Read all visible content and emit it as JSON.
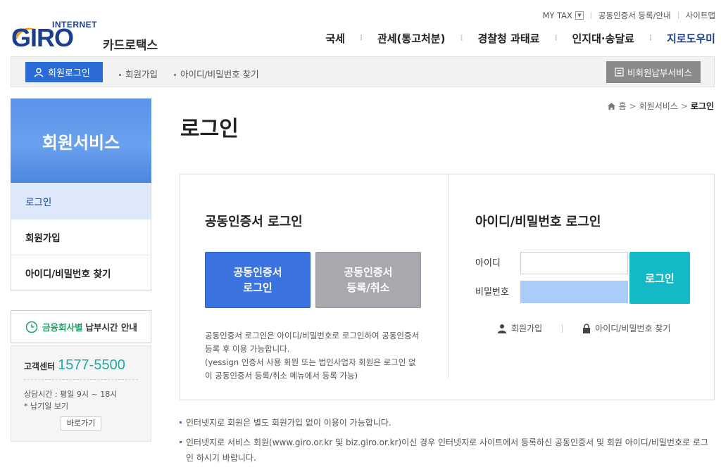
{
  "brand": {
    "internet": "INTERNET",
    "giro": "GIRO",
    "subtitle": "카드로택스",
    "color": "#1a3f8f"
  },
  "util_links": [
    "MY TAX",
    "공동인증서 등록/안내",
    "사이트맵"
  ],
  "gnb": [
    "국세",
    "관세(통고처분)",
    "경찰청 과태료",
    "인지대·송달료",
    "지로도우미"
  ],
  "subbar": {
    "login_button": "회원로그인",
    "links": [
      "회원가입",
      "아이디/비밀번호 찾기"
    ],
    "nonmember_button": "비회원납부서비스"
  },
  "lnb": {
    "title": "회원서비스",
    "items": [
      "로그인",
      "회원가입",
      "아이디/비밀번호 찾기"
    ]
  },
  "deadline": {
    "highlight": "금융회사별",
    "text": "납부시간 안내"
  },
  "customer_center": {
    "label": "고객센터",
    "phone": "1577-5500",
    "hours": "상담시간 : 평일 9시 ~ 18시",
    "holiday": "* 납기일 보기",
    "button": "바로가기"
  },
  "breadcrumb": [
    "홈",
    "회원서비스",
    "로그인"
  ],
  "page_title": "로그인",
  "cert_section": {
    "title": "공동인증서 로그인",
    "login_button_l1": "공동인증서",
    "login_button_l2": "로그인",
    "register_button_l1": "공동인증서",
    "register_button_l2": "등록/취소",
    "note_1": "공동인증서 로그인은 아이디/비밀번호로 로그인하여 공동인증서 등록 후 이용 가능합니다.",
    "note_2": "(yessign 인증서 사용 회원 또는 법인사업자 회원은 로그인 없이 공동인증서 등록/취소 메뉴에서 등록 가능)"
  },
  "id_section": {
    "title": "아이디/비밀번호 로그인",
    "id_label": "아이디",
    "pw_label": "비밀번호",
    "login_button": "로그인",
    "join_link": "회원가입",
    "find_link": "아이디/비밀번호 찾기"
  },
  "notes": [
    "인터넷지로 회원은 별도 회원가입 없이 이용이 가능합니다.",
    "인터넷지로 서비스 회원(www.giro.or.kr 및 biz.giro.or.kr)이신 경우 인터넷지로 사이트에서 등록하신 공동인증서 및 회원 아이디/비밀번호로 로그인 하시기 바랍니다."
  ]
}
